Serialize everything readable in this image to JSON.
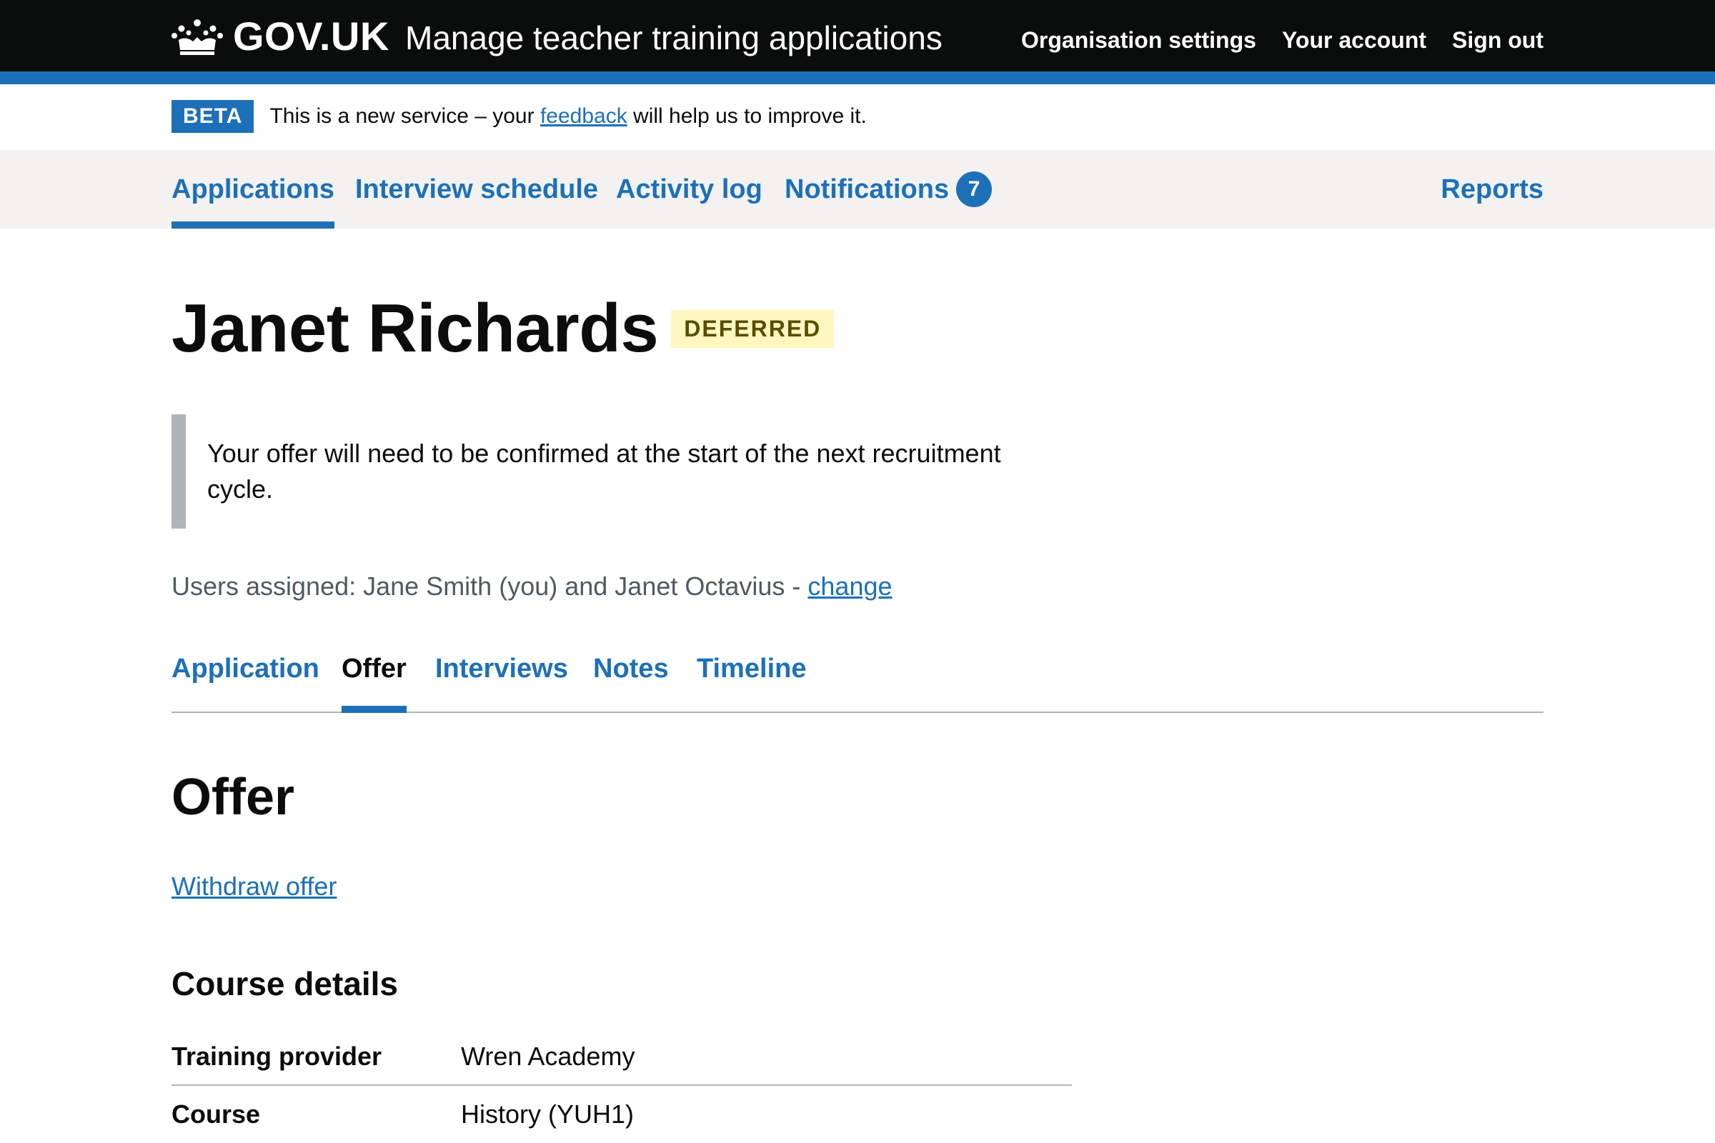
{
  "header": {
    "logo_text": "GOV.UK",
    "service_name": "Manage teacher training applications",
    "nav": [
      "Organisation settings",
      "Your account",
      "Sign out"
    ]
  },
  "beta": {
    "tag": "BETA",
    "text_before": "This is a new service – your ",
    "link": "feedback",
    "text_after": " will help us to improve it."
  },
  "primary_nav": {
    "items": [
      "Applications",
      "Interview schedule",
      "Activity log",
      "Notifications"
    ],
    "notifications_count": "7",
    "reports": "Reports",
    "active": "Applications"
  },
  "candidate": {
    "name": "Janet Richards",
    "status": "DEFERRED"
  },
  "inset_text": "Your offer will need to be confirmed at the start of the next recruitment cycle.",
  "assigned": {
    "text": "Users assigned: Jane Smith (you) and Janet Octavius - ",
    "link": "change"
  },
  "sub_nav": {
    "items": [
      "Application",
      "Offer",
      "Interviews",
      "Notes",
      "Timeline"
    ],
    "active": "Offer"
  },
  "section": {
    "title": "Offer",
    "withdraw_link": "Withdraw offer",
    "course_heading": "Course details"
  },
  "course_details": [
    {
      "key": "Training provider",
      "value": "Wren Academy"
    },
    {
      "key": "Course",
      "value": "History (YUH1)"
    }
  ],
  "colors": {
    "header_bg": "#0b0c0c",
    "brand_blue": "#1d70b8",
    "tag_yellow_bg": "#fff7bf",
    "tag_yellow_text": "#594d00"
  }
}
